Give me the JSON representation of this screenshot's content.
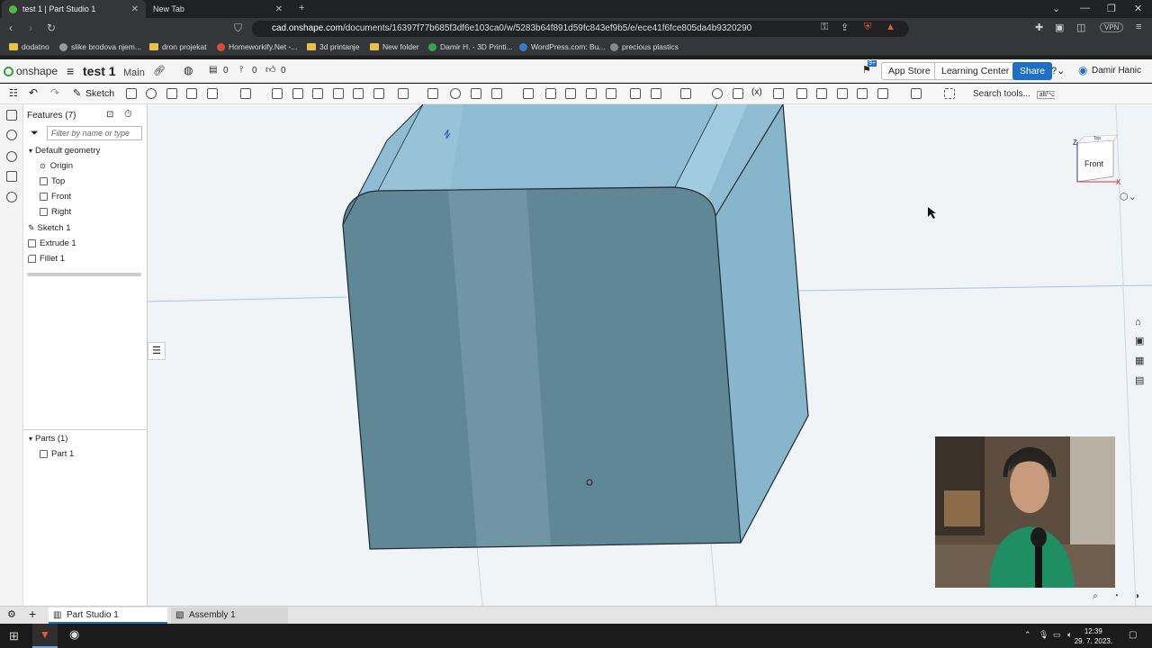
{
  "browser": {
    "tabs": [
      {
        "title": "test 1 | Part Studio 1",
        "active": true
      },
      {
        "title": "New Tab",
        "active": false
      }
    ],
    "url_host": "cad.onshape.com",
    "url_path": "/documents/16397f77b685f3df6e103ca0/w/5283b64f891d59fc843ef9b5/e/ece41f6fce805da4b9320290",
    "vpn_label": "VPN",
    "bookmarks": [
      {
        "label": "dodatno",
        "icon": "folder"
      },
      {
        "label": "slike brodova njem...",
        "icon": "site"
      },
      {
        "label": "dron projekat",
        "icon": "folder"
      },
      {
        "label": "Homeworkify.Net -...",
        "icon": "site"
      },
      {
        "label": "3d printanje",
        "icon": "folder"
      },
      {
        "label": "New folder",
        "icon": "folder"
      },
      {
        "label": "Damir H. - 3D Printi...",
        "icon": "site"
      },
      {
        "label": "WordPress.com: Bu...",
        "icon": "site"
      },
      {
        "label": "precious plastics",
        "icon": "site"
      }
    ]
  },
  "app": {
    "logo": "onshape",
    "document_name": "test 1",
    "branch": "Main",
    "counts": [
      "0",
      "0",
      "0"
    ],
    "notification_badge": "9+",
    "app_store": "App Store",
    "learning_center": "Learning Center",
    "share": "Share",
    "user": "Damir Hanic"
  },
  "toolbar": {
    "sketch": "Sketch",
    "search_tools": "Search tools...",
    "search_shortcut": "alt/⌥ c"
  },
  "features": {
    "title": "Features (7)",
    "filter_placeholder": "Filter by name or type",
    "default_geometry": "Default geometry",
    "items": [
      "Origin",
      "Top",
      "Front",
      "Right"
    ],
    "operations": [
      "Sketch 1",
      "Extrude 1",
      "Fillet 1"
    ],
    "parts_header": "Parts (1)",
    "parts": [
      "Part 1"
    ]
  },
  "viewcube": {
    "face": "Front",
    "top": "Top",
    "axis_z": "Z",
    "axis_x": "X"
  },
  "bottom_tabs": [
    {
      "label": "Part Studio 1",
      "active": true
    },
    {
      "label": "Assembly 1",
      "active": false
    }
  ],
  "taskbar": {
    "time": "12:39",
    "date": "29. 7. 2023."
  },
  "colors": {
    "accent": "#1f6fc6",
    "part_face": "#5f8796",
    "part_top": "#8fbcd3",
    "part_side": "#86b5cc",
    "viewport_bg": "#f0f4f7"
  }
}
